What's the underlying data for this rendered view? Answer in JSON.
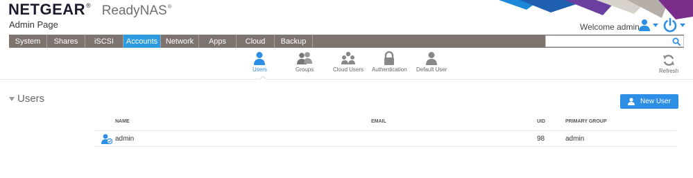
{
  "header": {
    "brand_name": "NETGEAR",
    "brand_reg": "®",
    "product": "ReadyNAS",
    "product_reg": "®",
    "page_label": "Admin Page",
    "welcome_text": "Welcome admin"
  },
  "nav": {
    "tabs": [
      {
        "label": "System"
      },
      {
        "label": "Shares"
      },
      {
        "label": "iSCSI"
      },
      {
        "label": "Accounts"
      },
      {
        "label": "Network"
      },
      {
        "label": "Apps"
      },
      {
        "label": "Cloud"
      },
      {
        "label": "Backup"
      }
    ],
    "active": "Accounts",
    "search_value": ""
  },
  "subtabs": {
    "items": [
      {
        "label": "Users",
        "icon": "user-icon"
      },
      {
        "label": "Groups",
        "icon": "group-icon"
      },
      {
        "label": "Cloud Users",
        "icon": "cloud-users-icon"
      },
      {
        "label": "Authentication",
        "icon": "lock-icon"
      },
      {
        "label": "Default User",
        "icon": "default-user-icon"
      }
    ],
    "active": "Users",
    "refresh_label": "Refresh"
  },
  "section": {
    "title": "Users",
    "new_user_label": "New User"
  },
  "table": {
    "columns": {
      "name": "NAME",
      "email": "EMAIL",
      "uid": "UID",
      "group": "PRIMARY GROUP"
    },
    "rows": [
      {
        "name": "admin",
        "email": "",
        "uid": "98",
        "group": "admin"
      }
    ]
  },
  "colors": {
    "accent": "#2d8ee6",
    "nav_bg": "#7d7470",
    "nav_active": "#2d9be0"
  }
}
